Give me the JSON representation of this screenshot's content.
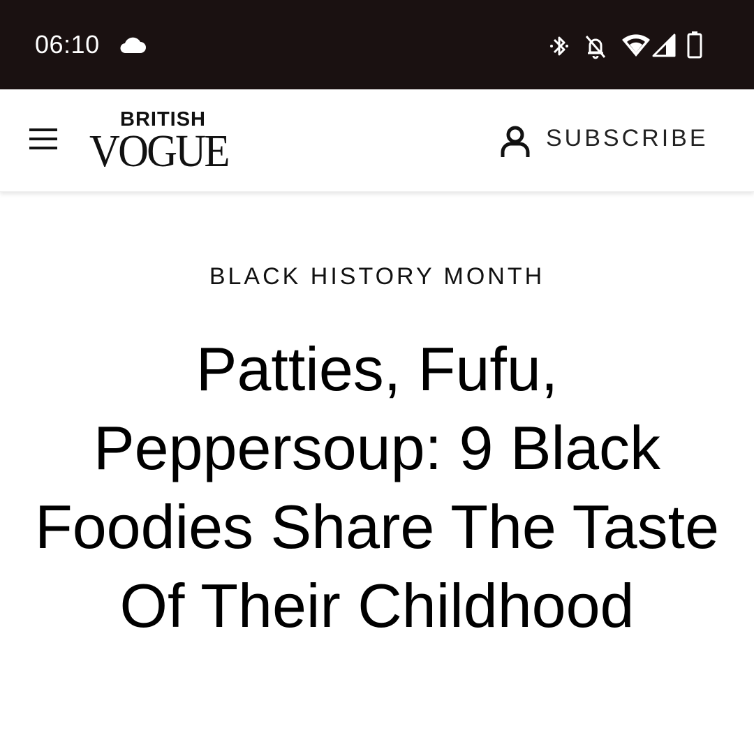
{
  "status_bar": {
    "time": "06:10",
    "icons": [
      "cloud-icon",
      "bluetooth-icon",
      "notifications-off-icon",
      "wifi-icon",
      "cell-signal-icon",
      "battery-icon"
    ]
  },
  "header": {
    "logo_top": "BRITISH",
    "logo_main": "VOGUE",
    "subscribe_label": "SUBSCRIBE",
    "menu_icon": "hamburger-menu-icon",
    "user_icon": "user-icon"
  },
  "article": {
    "eyebrow": "BLACK HISTORY MONTH",
    "headline": "Patties, Fufu, Peppersoup: 9 Black Foodies Share The Taste Of Their Childhood"
  },
  "colors": {
    "status_bar_bg": "#1a1111",
    "text": "#000000",
    "background": "#ffffff"
  }
}
